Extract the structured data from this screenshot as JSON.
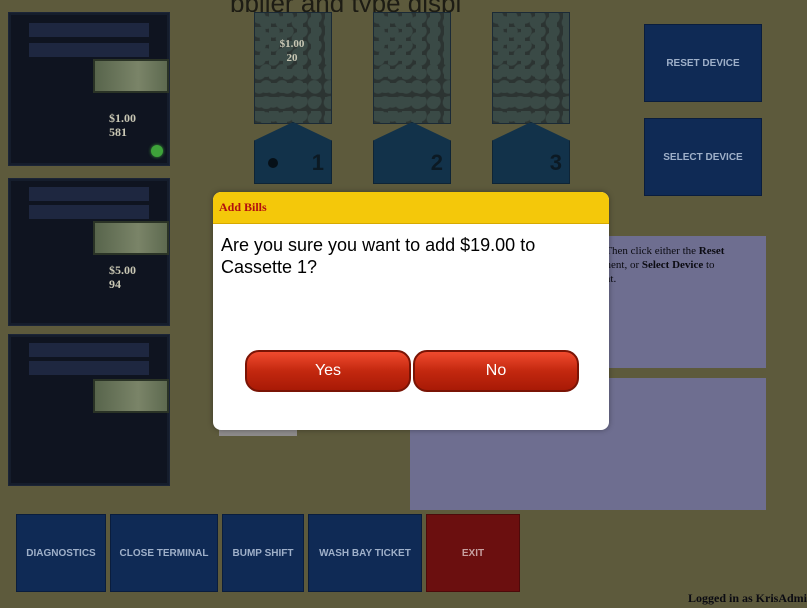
{
  "header_partial": "pplier and type displ",
  "acceptors": [
    {
      "denomination": "$1.00",
      "count": "581",
      "bill_note": "10"
    },
    {
      "denomination": "$5.00",
      "count": "94",
      "bill_note": "10"
    },
    {
      "denomination": "",
      "count": "",
      "bill_note": "10"
    }
  ],
  "hoppers": [
    {
      "number": "1",
      "value": "$1.00",
      "count": "20"
    },
    {
      "number": "2",
      "value": "",
      "count": ""
    },
    {
      "number": "3",
      "value": "",
      "count": ""
    }
  ],
  "side_buttons": {
    "reset": "RESET DEVICE",
    "select": "SELECT DEVICE"
  },
  "panel": {
    "part1": ". Then click either the ",
    "reset_word": "Reset",
    "part2": "onent, or ",
    "select_word": "Select Device",
    "part3": " to",
    "part4": "ent."
  },
  "bottom_buttons": {
    "diagnostics": "DIAGNOSTICS",
    "close_terminal": "CLOSE TERMINAL",
    "bump_shift": "BUMP SHIFT",
    "wash_bay_ticket": "WASH BAY TICKET",
    "exit": "EXIT"
  },
  "status": {
    "logged_in": "Logged in as KrisAdmi"
  },
  "dialog": {
    "title": "Add Bills",
    "message": "Are you sure you want to add $19.00 to Cassette 1?",
    "yes": "Yes",
    "no": "No"
  },
  "colors": {
    "dialog_header": "#f4c80a",
    "button_red": "#c3280f",
    "nav_blue": "#0f2a55",
    "exit_red": "#6b0f0f"
  }
}
